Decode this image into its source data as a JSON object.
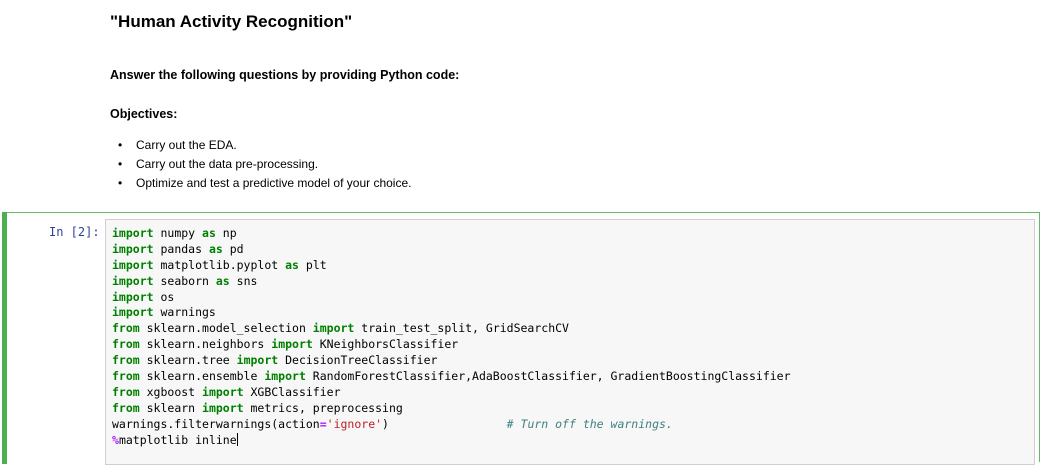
{
  "markdown": {
    "title": "\"Human Activity Recognition\"",
    "question": "Answer the following questions by providing Python code:",
    "objectives_heading": "Objectives:",
    "bullet_glyph": "•",
    "objectives": [
      "Carry out the EDA.",
      "Carry out the data pre-processing.",
      "Optimize and test a predictive model of your choice."
    ]
  },
  "code_cell": {
    "prompt": "In [2]:",
    "lines": [
      [
        {
          "t": "kw",
          "v": "import"
        },
        {
          "t": "p",
          "v": " numpy "
        },
        {
          "t": "kw",
          "v": "as"
        },
        {
          "t": "p",
          "v": " np"
        }
      ],
      [
        {
          "t": "kw",
          "v": "import"
        },
        {
          "t": "p",
          "v": " pandas "
        },
        {
          "t": "kw",
          "v": "as"
        },
        {
          "t": "p",
          "v": " pd"
        }
      ],
      [
        {
          "t": "kw",
          "v": "import"
        },
        {
          "t": "p",
          "v": " matplotlib.pyplot "
        },
        {
          "t": "kw",
          "v": "as"
        },
        {
          "t": "p",
          "v": " plt"
        }
      ],
      [
        {
          "t": "kw",
          "v": "import"
        },
        {
          "t": "p",
          "v": " seaborn "
        },
        {
          "t": "kw",
          "v": "as"
        },
        {
          "t": "p",
          "v": " sns"
        }
      ],
      [
        {
          "t": "kw",
          "v": "import"
        },
        {
          "t": "p",
          "v": " os"
        }
      ],
      [
        {
          "t": "kw",
          "v": "import"
        },
        {
          "t": "p",
          "v": " warnings"
        }
      ],
      [
        {
          "t": "kw",
          "v": "from"
        },
        {
          "t": "p",
          "v": " sklearn.model_selection "
        },
        {
          "t": "kw",
          "v": "import"
        },
        {
          "t": "p",
          "v": " train_test_split, GridSearchCV"
        }
      ],
      [
        {
          "t": "kw",
          "v": "from"
        },
        {
          "t": "p",
          "v": " sklearn.neighbors "
        },
        {
          "t": "kw",
          "v": "import"
        },
        {
          "t": "p",
          "v": " KNeighborsClassifier"
        }
      ],
      [
        {
          "t": "kw",
          "v": "from"
        },
        {
          "t": "p",
          "v": " sklearn.tree "
        },
        {
          "t": "kw",
          "v": "import"
        },
        {
          "t": "p",
          "v": " DecisionTreeClassifier"
        }
      ],
      [
        {
          "t": "kw",
          "v": "from"
        },
        {
          "t": "p",
          "v": " sklearn.ensemble "
        },
        {
          "t": "kw",
          "v": "import"
        },
        {
          "t": "p",
          "v": " RandomForestClassifier,AdaBoostClassifier, GradientBoostingClassifier"
        }
      ],
      [
        {
          "t": "kw",
          "v": "from"
        },
        {
          "t": "p",
          "v": " xgboost "
        },
        {
          "t": "kw",
          "v": "import"
        },
        {
          "t": "p",
          "v": " XGBClassifier"
        }
      ],
      [
        {
          "t": "kw",
          "v": "from"
        },
        {
          "t": "p",
          "v": " sklearn "
        },
        {
          "t": "kw",
          "v": "import"
        },
        {
          "t": "p",
          "v": " metrics, preprocessing"
        }
      ],
      [
        {
          "t": "p",
          "v": "warnings.filterwarnings(action"
        },
        {
          "t": "op",
          "v": "="
        },
        {
          "t": "str",
          "v": "'ignore'"
        },
        {
          "t": "p",
          "v": ")                 "
        },
        {
          "t": "cmt",
          "v": "# Turn off the warnings."
        }
      ],
      [
        {
          "t": "magic",
          "v": "%"
        },
        {
          "t": "p",
          "v": "matplotlib inline"
        },
        {
          "t": "cursor",
          "v": ""
        }
      ]
    ]
  },
  "colors": {
    "cell_border_selected": "#66bb6a",
    "selection_bar": "#4caf50",
    "prompt": "#303f9f",
    "keyword": "#008000",
    "string": "#ba2121",
    "comment": "#408080",
    "operator": "#aa22ff",
    "input_background": "#f7f7f7"
  }
}
